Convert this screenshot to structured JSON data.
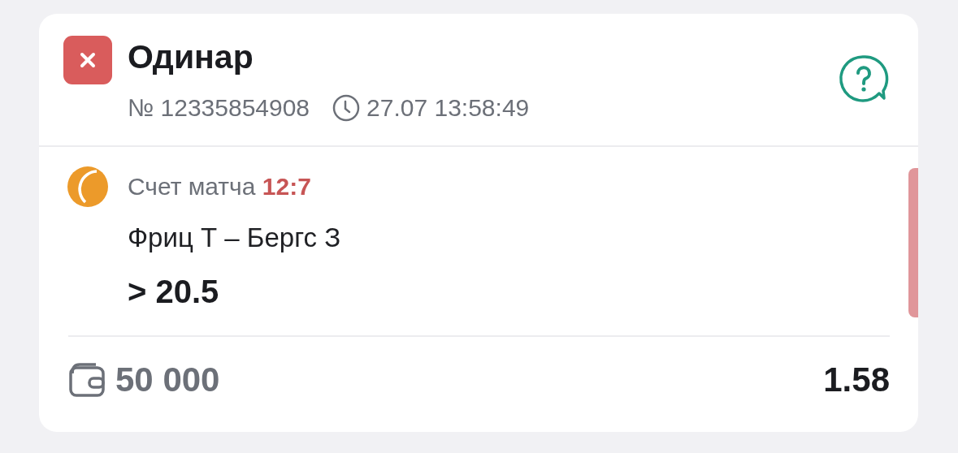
{
  "bet": {
    "lost": true,
    "title": "Одинар",
    "number": "№ 12335854908",
    "time": "27.07 13:58:49"
  },
  "event": {
    "score_label": "Счет матча",
    "score": "12:7",
    "match": "Фриц Т – Бергс З",
    "outcome": "> 20.5"
  },
  "footer": {
    "stake": "50 000",
    "odds": "1.58"
  }
}
